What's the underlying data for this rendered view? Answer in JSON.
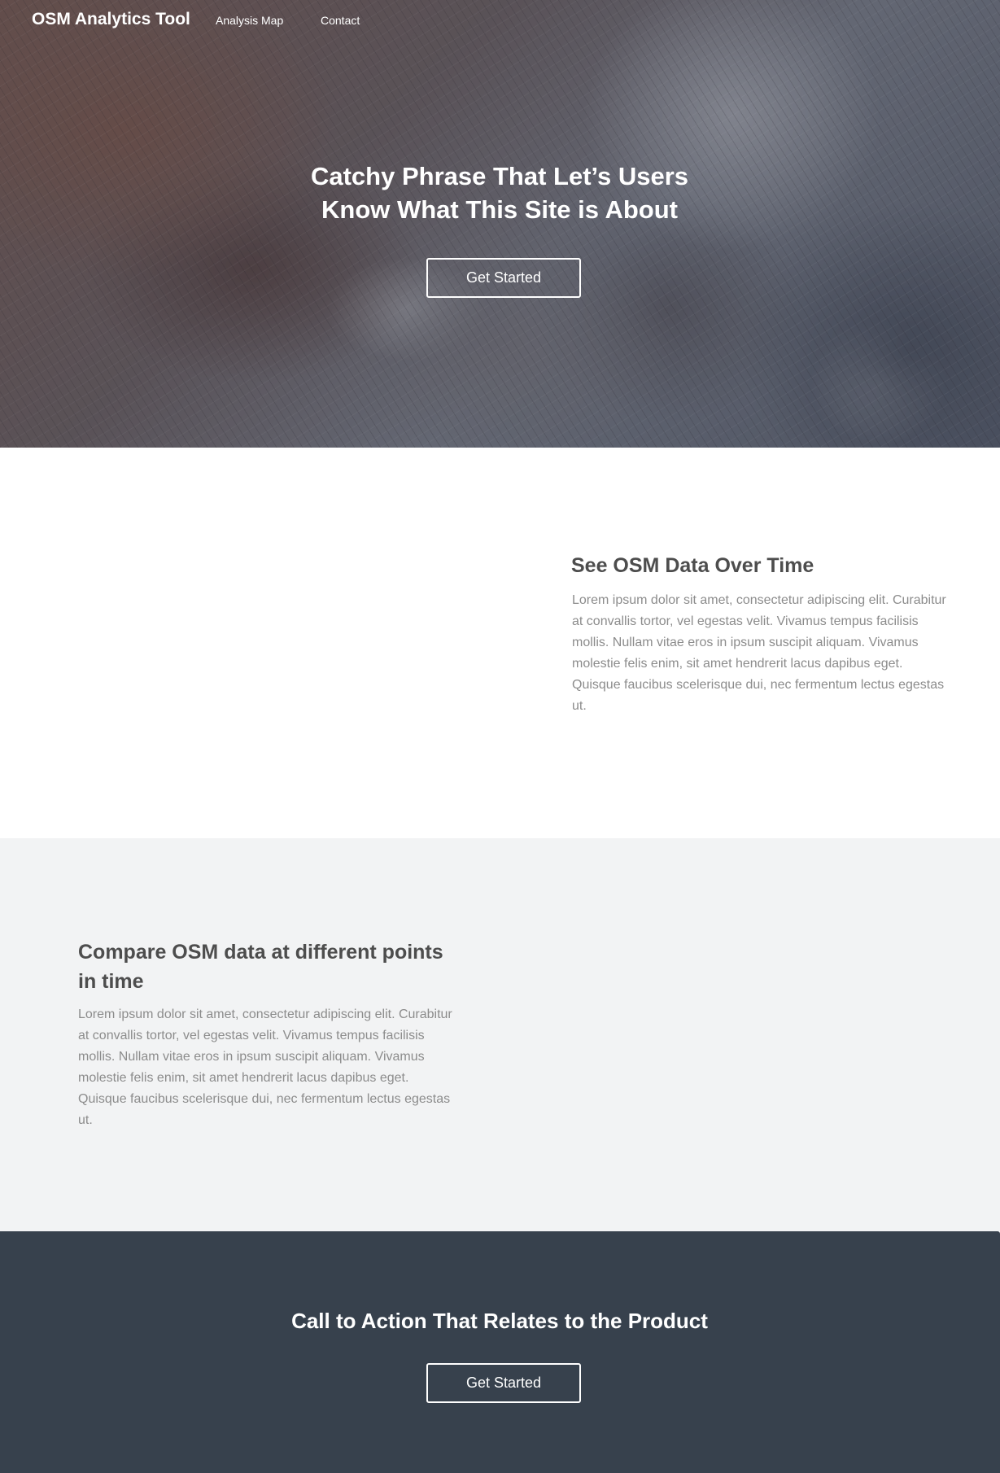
{
  "navbar": {
    "brand": "OSM Analytics Tool",
    "links": [
      "Analysis Map",
      "Contact"
    ]
  },
  "hero": {
    "title_line1": "Catchy Phrase That Let’s Users",
    "title_line2": "Know What This Site is About",
    "button_label": "Get Started"
  },
  "feature1": {
    "heading": "See OSM Data Over Time",
    "body": "Lorem ipsum dolor sit amet, consectetur adipiscing elit. Curabitur at convallis tortor, vel egestas velit. Vivamus tempus facilisis mollis. Nullam vitae eros in ipsum suscipit aliquam. Vivamus molestie felis enim, sit amet hendrerit lacus dapibus eget. Quisque faucibus scelerisque dui, nec fermentum lectus egestas ut."
  },
  "feature2": {
    "heading": "Compare OSM data at different points in time",
    "body": "Lorem ipsum dolor sit amet, consectetur adipiscing elit. Curabitur at convallis tortor, vel egestas velit. Vivamus tempus facilisis mollis. Nullam vitae eros in ipsum suscipit aliquam. Vivamus molestie felis enim, sit amet hendrerit lacus dapibus eget. Quisque faucibus scelerisque dui, nec fermentum lectus egestas ut."
  },
  "cta": {
    "title": "Call to Action That Relates to the Product",
    "button_label": "Get Started"
  },
  "colors": {
    "cta_background": "#37414d",
    "feature2_background": "#f2f3f4",
    "heading_text": "#4d4d4d",
    "body_text": "#8c8c8c",
    "button_border": "#ffffff"
  }
}
